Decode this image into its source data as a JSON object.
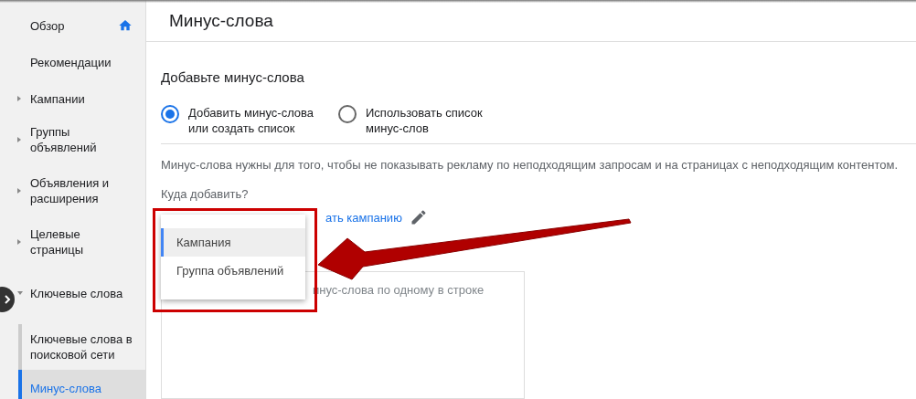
{
  "sidebar": {
    "items": [
      {
        "label": "Обзор",
        "kind": "home"
      },
      {
        "label": "Рекомендации",
        "kind": "plain"
      },
      {
        "label": "Кампании",
        "kind": "collapsed"
      },
      {
        "label": "Группы объявлений",
        "kind": "collapsed"
      },
      {
        "label": "Объявления и расширения",
        "kind": "collapsed"
      },
      {
        "label": "Целевые страницы",
        "kind": "collapsed"
      },
      {
        "label": "Ключевые слова",
        "kind": "expanded",
        "children": [
          {
            "label": "Ключевые слова в поисковой сети",
            "selected": false
          },
          {
            "label": "Минус-слова",
            "selected": true
          }
        ]
      }
    ]
  },
  "page_title": "Минус-слова",
  "section_title": "Добавьте минус-слова",
  "options": [
    {
      "label": "Добавить минус-слова или создать список",
      "selected": true
    },
    {
      "label": "Использовать список минус-слов",
      "selected": false
    }
  ],
  "description": "Минус-слова нужны для того, чтобы не показывать рекламу по неподходящим запросам и на страницах с неподходящим контентом.",
  "target_label": "Куда добавить?",
  "target_link": "ать кампанию",
  "keywords_placeholder": "инус-слова по одному в строке",
  "menu": [
    {
      "label": "Кампания",
      "selected": true
    },
    {
      "label": "Группа объявлений",
      "selected": false
    }
  ]
}
